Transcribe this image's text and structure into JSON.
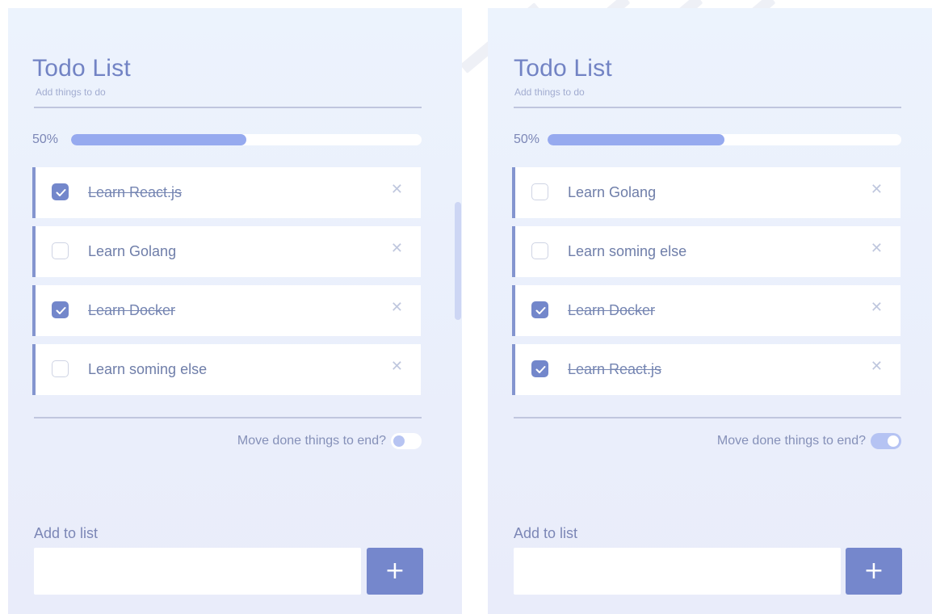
{
  "colors": {
    "accent": "#7387cb",
    "progress_fill": "#96aaef",
    "panel_bg": "#ecf3fd",
    "text": "#6f7ea9"
  },
  "panels": [
    {
      "title": "Todo List",
      "subtitle": "Add things to do",
      "progress": {
        "label": "50%",
        "percent": 50
      },
      "items": [
        {
          "label": "Learn React.js",
          "done": true,
          "remove_icon": "close-icon"
        },
        {
          "label": "Learn Golang",
          "done": false,
          "remove_icon": "close-icon"
        },
        {
          "label": "Learn Docker",
          "done": true,
          "remove_icon": "close-icon"
        },
        {
          "label": "Learn soming else",
          "done": false,
          "remove_icon": "close-icon"
        }
      ],
      "toggle": {
        "label": "Move done things to end?",
        "on": false
      },
      "add": {
        "label": "Add to list",
        "value": "",
        "button_label": "+"
      }
    },
    {
      "title": "Todo List",
      "subtitle": "Add things to do",
      "progress": {
        "label": "50%",
        "percent": 50
      },
      "items": [
        {
          "label": "Learn Golang",
          "done": false,
          "remove_icon": "close-icon"
        },
        {
          "label": "Learn soming else",
          "done": false,
          "remove_icon": "close-icon"
        },
        {
          "label": "Learn Docker",
          "done": true,
          "remove_icon": "close-icon"
        },
        {
          "label": "Learn React.js",
          "done": true,
          "remove_icon": "close-icon"
        }
      ],
      "toggle": {
        "label": "Move done things to end?",
        "on": true
      },
      "add": {
        "label": "Add to list",
        "value": "",
        "button_label": "+"
      }
    }
  ]
}
